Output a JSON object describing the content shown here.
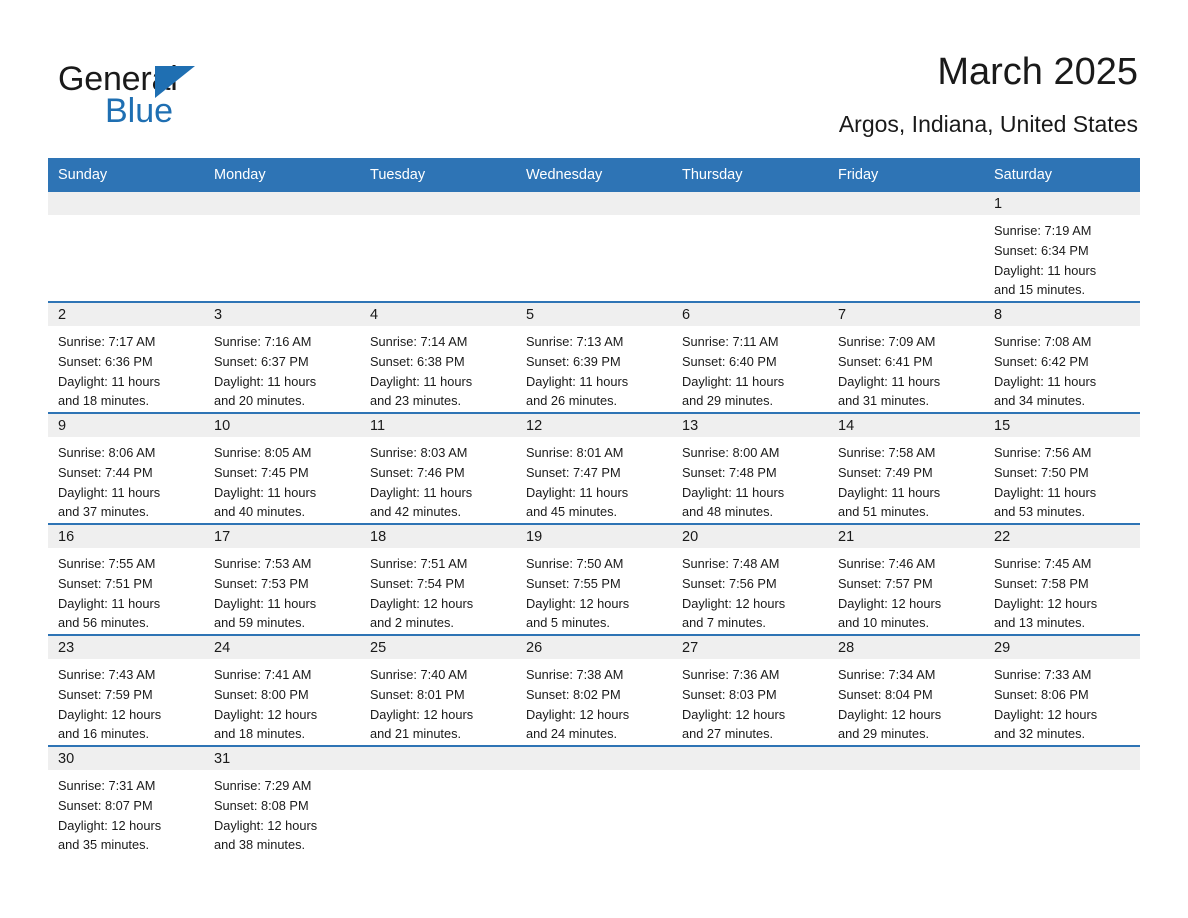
{
  "brand": {
    "word1": "General",
    "word2": "Blue",
    "flag_icon": "triangle-flag-icon",
    "accent_color": "#1f6fb2"
  },
  "header": {
    "title": "March 2025",
    "location": "Argos, Indiana, United States"
  },
  "theme": {
    "header_bg": "#2e74b5",
    "daynum_bg": "#efefef",
    "separator": "#2e74b5",
    "text": "#1a1a1a"
  },
  "weekdays": [
    "Sunday",
    "Monday",
    "Tuesday",
    "Wednesday",
    "Thursday",
    "Friday",
    "Saturday"
  ],
  "weeks": [
    [
      {
        "day": "",
        "empty": true
      },
      {
        "day": "",
        "empty": true
      },
      {
        "day": "",
        "empty": true
      },
      {
        "day": "",
        "empty": true
      },
      {
        "day": "",
        "empty": true
      },
      {
        "day": "",
        "empty": true
      },
      {
        "day": "1",
        "sunrise": "Sunrise: 7:19 AM",
        "sunset": "Sunset: 6:34 PM",
        "daylight1": "Daylight: 11 hours",
        "daylight2": "and 15 minutes."
      }
    ],
    [
      {
        "day": "2",
        "sunrise": "Sunrise: 7:17 AM",
        "sunset": "Sunset: 6:36 PM",
        "daylight1": "Daylight: 11 hours",
        "daylight2": "and 18 minutes."
      },
      {
        "day": "3",
        "sunrise": "Sunrise: 7:16 AM",
        "sunset": "Sunset: 6:37 PM",
        "daylight1": "Daylight: 11 hours",
        "daylight2": "and 20 minutes."
      },
      {
        "day": "4",
        "sunrise": "Sunrise: 7:14 AM",
        "sunset": "Sunset: 6:38 PM",
        "daylight1": "Daylight: 11 hours",
        "daylight2": "and 23 minutes."
      },
      {
        "day": "5",
        "sunrise": "Sunrise: 7:13 AM",
        "sunset": "Sunset: 6:39 PM",
        "daylight1": "Daylight: 11 hours",
        "daylight2": "and 26 minutes."
      },
      {
        "day": "6",
        "sunrise": "Sunrise: 7:11 AM",
        "sunset": "Sunset: 6:40 PM",
        "daylight1": "Daylight: 11 hours",
        "daylight2": "and 29 minutes."
      },
      {
        "day": "7",
        "sunrise": "Sunrise: 7:09 AM",
        "sunset": "Sunset: 6:41 PM",
        "daylight1": "Daylight: 11 hours",
        "daylight2": "and 31 minutes."
      },
      {
        "day": "8",
        "sunrise": "Sunrise: 7:08 AM",
        "sunset": "Sunset: 6:42 PM",
        "daylight1": "Daylight: 11 hours",
        "daylight2": "and 34 minutes."
      }
    ],
    [
      {
        "day": "9",
        "sunrise": "Sunrise: 8:06 AM",
        "sunset": "Sunset: 7:44 PM",
        "daylight1": "Daylight: 11 hours",
        "daylight2": "and 37 minutes."
      },
      {
        "day": "10",
        "sunrise": "Sunrise: 8:05 AM",
        "sunset": "Sunset: 7:45 PM",
        "daylight1": "Daylight: 11 hours",
        "daylight2": "and 40 minutes."
      },
      {
        "day": "11",
        "sunrise": "Sunrise: 8:03 AM",
        "sunset": "Sunset: 7:46 PM",
        "daylight1": "Daylight: 11 hours",
        "daylight2": "and 42 minutes."
      },
      {
        "day": "12",
        "sunrise": "Sunrise: 8:01 AM",
        "sunset": "Sunset: 7:47 PM",
        "daylight1": "Daylight: 11 hours",
        "daylight2": "and 45 minutes."
      },
      {
        "day": "13",
        "sunrise": "Sunrise: 8:00 AM",
        "sunset": "Sunset: 7:48 PM",
        "daylight1": "Daylight: 11 hours",
        "daylight2": "and 48 minutes."
      },
      {
        "day": "14",
        "sunrise": "Sunrise: 7:58 AM",
        "sunset": "Sunset: 7:49 PM",
        "daylight1": "Daylight: 11 hours",
        "daylight2": "and 51 minutes."
      },
      {
        "day": "15",
        "sunrise": "Sunrise: 7:56 AM",
        "sunset": "Sunset: 7:50 PM",
        "daylight1": "Daylight: 11 hours",
        "daylight2": "and 53 minutes."
      }
    ],
    [
      {
        "day": "16",
        "sunrise": "Sunrise: 7:55 AM",
        "sunset": "Sunset: 7:51 PM",
        "daylight1": "Daylight: 11 hours",
        "daylight2": "and 56 minutes."
      },
      {
        "day": "17",
        "sunrise": "Sunrise: 7:53 AM",
        "sunset": "Sunset: 7:53 PM",
        "daylight1": "Daylight: 11 hours",
        "daylight2": "and 59 minutes."
      },
      {
        "day": "18",
        "sunrise": "Sunrise: 7:51 AM",
        "sunset": "Sunset: 7:54 PM",
        "daylight1": "Daylight: 12 hours",
        "daylight2": "and 2 minutes."
      },
      {
        "day": "19",
        "sunrise": "Sunrise: 7:50 AM",
        "sunset": "Sunset: 7:55 PM",
        "daylight1": "Daylight: 12 hours",
        "daylight2": "and 5 minutes."
      },
      {
        "day": "20",
        "sunrise": "Sunrise: 7:48 AM",
        "sunset": "Sunset: 7:56 PM",
        "daylight1": "Daylight: 12 hours",
        "daylight2": "and 7 minutes."
      },
      {
        "day": "21",
        "sunrise": "Sunrise: 7:46 AM",
        "sunset": "Sunset: 7:57 PM",
        "daylight1": "Daylight: 12 hours",
        "daylight2": "and 10 minutes."
      },
      {
        "day": "22",
        "sunrise": "Sunrise: 7:45 AM",
        "sunset": "Sunset: 7:58 PM",
        "daylight1": "Daylight: 12 hours",
        "daylight2": "and 13 minutes."
      }
    ],
    [
      {
        "day": "23",
        "sunrise": "Sunrise: 7:43 AM",
        "sunset": "Sunset: 7:59 PM",
        "daylight1": "Daylight: 12 hours",
        "daylight2": "and 16 minutes."
      },
      {
        "day": "24",
        "sunrise": "Sunrise: 7:41 AM",
        "sunset": "Sunset: 8:00 PM",
        "daylight1": "Daylight: 12 hours",
        "daylight2": "and 18 minutes."
      },
      {
        "day": "25",
        "sunrise": "Sunrise: 7:40 AM",
        "sunset": "Sunset: 8:01 PM",
        "daylight1": "Daylight: 12 hours",
        "daylight2": "and 21 minutes."
      },
      {
        "day": "26",
        "sunrise": "Sunrise: 7:38 AM",
        "sunset": "Sunset: 8:02 PM",
        "daylight1": "Daylight: 12 hours",
        "daylight2": "and 24 minutes."
      },
      {
        "day": "27",
        "sunrise": "Sunrise: 7:36 AM",
        "sunset": "Sunset: 8:03 PM",
        "daylight1": "Daylight: 12 hours",
        "daylight2": "and 27 minutes."
      },
      {
        "day": "28",
        "sunrise": "Sunrise: 7:34 AM",
        "sunset": "Sunset: 8:04 PM",
        "daylight1": "Daylight: 12 hours",
        "daylight2": "and 29 minutes."
      },
      {
        "day": "29",
        "sunrise": "Sunrise: 7:33 AM",
        "sunset": "Sunset: 8:06 PM",
        "daylight1": "Daylight: 12 hours",
        "daylight2": "and 32 minutes."
      }
    ],
    [
      {
        "day": "30",
        "sunrise": "Sunrise: 7:31 AM",
        "sunset": "Sunset: 8:07 PM",
        "daylight1": "Daylight: 12 hours",
        "daylight2": "and 35 minutes."
      },
      {
        "day": "31",
        "sunrise": "Sunrise: 7:29 AM",
        "sunset": "Sunset: 8:08 PM",
        "daylight1": "Daylight: 12 hours",
        "daylight2": "and 38 minutes."
      },
      {
        "day": "",
        "empty": true
      },
      {
        "day": "",
        "empty": true
      },
      {
        "day": "",
        "empty": true
      },
      {
        "day": "",
        "empty": true
      },
      {
        "day": "",
        "empty": true
      }
    ]
  ]
}
